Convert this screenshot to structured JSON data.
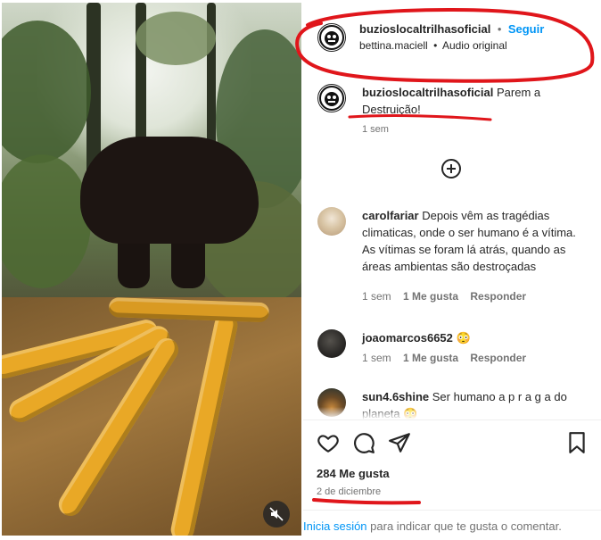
{
  "post": {
    "username": "buzioslocaltrilhasoficial",
    "dot": "•",
    "follow_label": "Seguir",
    "audio_user": "bettina.maciell",
    "audio_label": "Audio original"
  },
  "caption": {
    "username": "buzioslocaltrilhasoficial",
    "text": "Parem a Destruição!",
    "time": "1 sem"
  },
  "comments": [
    {
      "username": "carolfariar",
      "text": "Depois vêm as tragédias climaticas, onde o ser humano é a vítima. As vítimas se foram lá atrás, quando as áreas ambientas são destroçadas",
      "time": "1 sem",
      "likes": "1 Me gusta",
      "reply": "Responder"
    },
    {
      "username": "joaomarcos6652",
      "text": "😳",
      "time": "1 sem",
      "likes": "1 Me gusta",
      "reply": "Responder"
    },
    {
      "username": "sun4.6shine",
      "text": "Ser humano a p r a g a do planeta 😳"
    }
  ],
  "actions": {
    "like_count": "284 Me gusta",
    "date": "2 de diciembre",
    "login_link": "Inicia sesión",
    "login_text": "para indicar que te gusta o comentar."
  },
  "colors": {
    "link_blue": "#0095f6",
    "annotation_red": "#e0161b",
    "text": "#262626",
    "muted": "#737373"
  },
  "icons": [
    "mute-icon",
    "add-circle-icon",
    "heart-icon",
    "comment-icon",
    "share-icon",
    "bookmark-icon"
  ]
}
